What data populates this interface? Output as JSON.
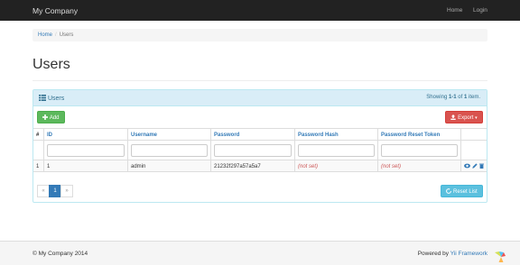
{
  "navbar": {
    "brand": "My Company",
    "links": [
      "Home",
      "Login"
    ]
  },
  "breadcrumb": {
    "home": "Home",
    "separator": "/",
    "current": "Users"
  },
  "page_title": "Users",
  "panel": {
    "title": "Users",
    "summary": {
      "prefix": "Showing ",
      "range": "1-1",
      "middle": " of ",
      "total": "1",
      "suffix": " item."
    },
    "add_label": "Add",
    "export_label": "Export",
    "reset_label": "Reset List"
  },
  "table": {
    "columns": [
      "#",
      "ID",
      "Username",
      "Password",
      "Password Hash",
      "Password Reset Token"
    ],
    "rows": [
      {
        "num": "1",
        "id": "1",
        "username": "admin",
        "password": "21232f297a57a5a7",
        "password_hash": "(not set)",
        "reset_token": "(not set)"
      }
    ]
  },
  "pagination": {
    "prev": "«",
    "current": "1",
    "next": "»"
  },
  "footer": {
    "copyright": "© My Company 2014",
    "powered_prefix": "Powered by ",
    "framework": "Yii Framework"
  },
  "colors": {
    "navbar": "#222222",
    "accent": "#337ab7",
    "success": "#5cb85c",
    "danger": "#d9534f",
    "info": "#5bc0de"
  },
  "icons": [
    "list-icon",
    "plus-icon",
    "export-icon",
    "caret-down-icon",
    "view-icon",
    "edit-icon",
    "delete-icon",
    "refresh-icon",
    "yii-logo"
  ]
}
